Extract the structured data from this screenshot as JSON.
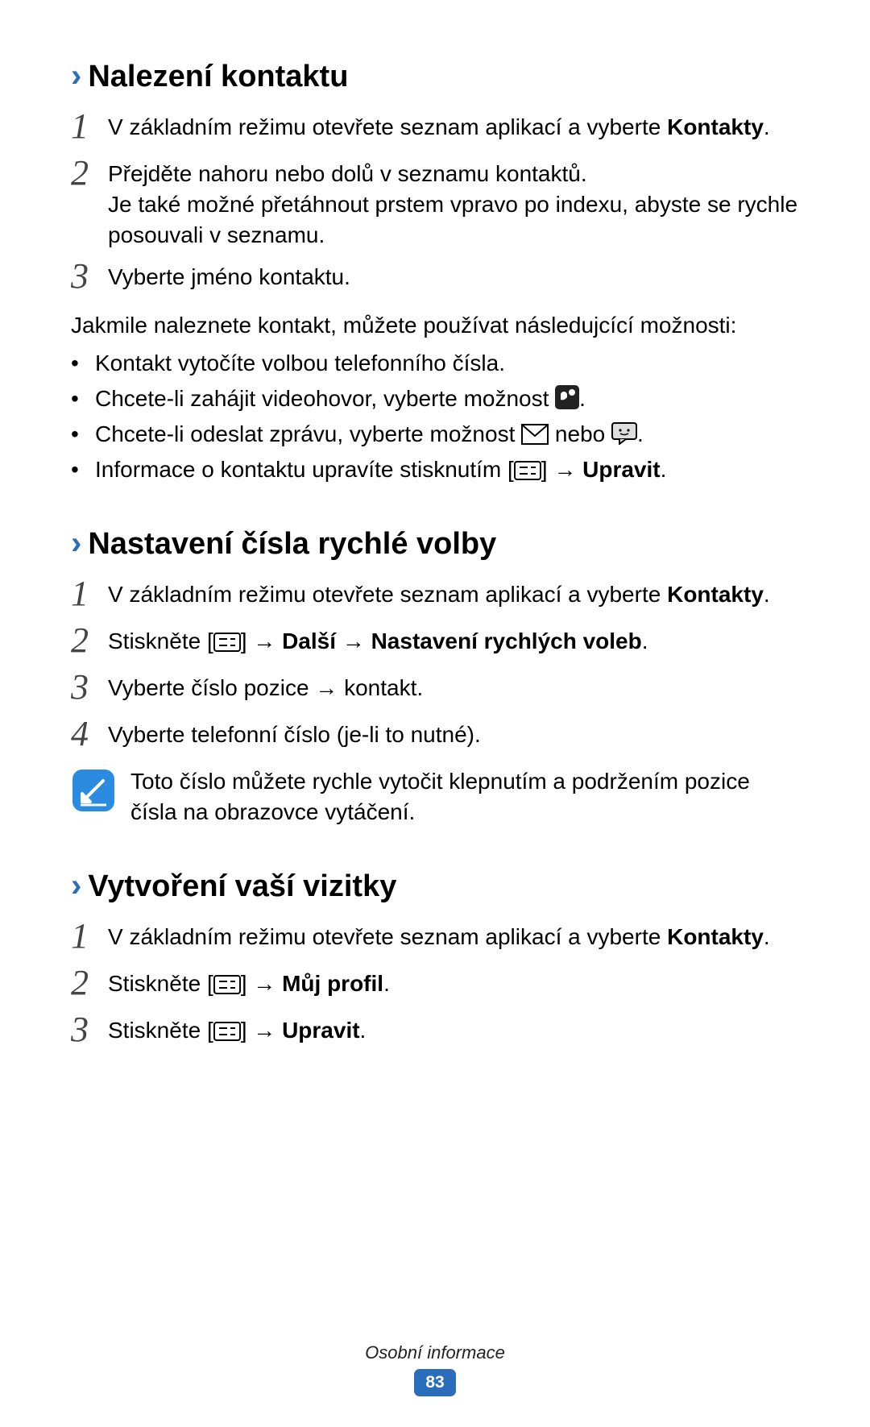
{
  "sections": [
    {
      "title": "Nalezení kontaktu",
      "steps": [
        {
          "n": "1",
          "text_a": "V základním režimu otevřete seznam aplikací a vyberte ",
          "bold_a": "Kontakty",
          "text_b": "."
        },
        {
          "n": "2",
          "text_a": "Přejděte nahoru nebo dolů v seznamu kontaktů.",
          "extra": "Je také možné přetáhnout prstem vpravo po indexu, abyste se rychle posouvali v seznamu."
        },
        {
          "n": "3",
          "text_a": "Vyberte jméno kontaktu."
        }
      ],
      "para": "Jakmile naleznete kontakt, můžete používat následujcící možnosti:",
      "bullets": [
        {
          "text_a": "Kontakt vytočíte volbou telefonního čísla."
        },
        {
          "text_a": "Chcete-li zahájit videohovor, vyberte možnost ",
          "icon_a": "videocall",
          "text_b": "."
        },
        {
          "text_a": "Chcete-li odeslat zprávu, vyberte možnost ",
          "icon_a": "envelope",
          "text_b": " nebo ",
          "icon_b": "chat",
          "text_c": "."
        },
        {
          "text_a": "Informace o kontaktu upravíte stisknutím [",
          "icon_a": "menu",
          "text_b": "] → ",
          "bold_a": "Upravit",
          "text_c": "."
        }
      ]
    },
    {
      "title": "Nastavení čísla rychlé volby",
      "steps": [
        {
          "n": "1",
          "text_a": "V základním režimu otevřete seznam aplikací a vyberte ",
          "bold_a": "Kontakty",
          "text_b": "."
        },
        {
          "n": "2",
          "text_a": "Stiskněte [",
          "icon_a": "menu",
          "text_b": "] → ",
          "bold_a": "Další",
          "text_c": " → ",
          "bold_b": "Nastavení rychlých voleb",
          "text_d": "."
        },
        {
          "n": "3",
          "text_a": "Vyberte číslo pozice → kontakt."
        },
        {
          "n": "4",
          "text_a": "Vyberte telefonní číslo (je-li to nutné)."
        }
      ],
      "note": "Toto číslo můžete rychle vytočit klepnutím a podržením pozice čísla na obrazovce vytáčení."
    },
    {
      "title": "Vytvoření vaší vizitky",
      "steps": [
        {
          "n": "1",
          "text_a": "V základním režimu otevřete seznam aplikací a vyberte ",
          "bold_a": "Kontakty",
          "text_b": "."
        },
        {
          "n": "2",
          "text_a": "Stiskněte [",
          "icon_a": "menu",
          "text_b": "] → ",
          "bold_a": "Můj profil",
          "text_c": "."
        },
        {
          "n": "3",
          "text_a": "Stiskněte [",
          "icon_a": "menu",
          "text_b": "] → ",
          "bold_a": "Upravit",
          "text_c": "."
        }
      ]
    }
  ],
  "footer": {
    "label": "Osobní informace",
    "page": "83"
  },
  "bullet_char": "•"
}
